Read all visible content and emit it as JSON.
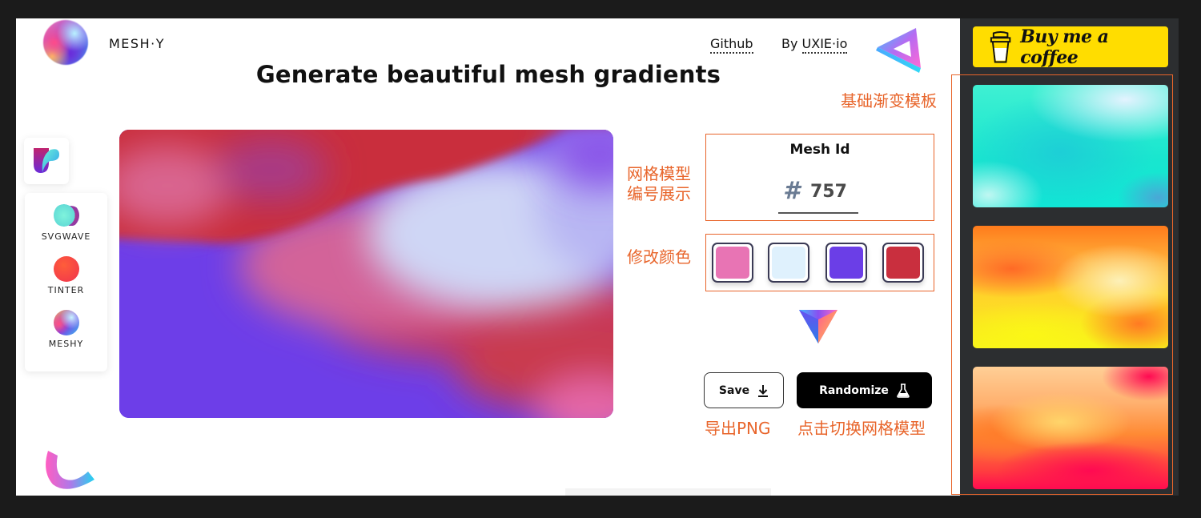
{
  "header": {
    "brand": "MESH·Y",
    "title": "Generate beautiful mesh gradients",
    "links": [
      {
        "label": "Github"
      },
      {
        "prefix": "By ",
        "label": "UXIE·io"
      }
    ]
  },
  "sidebar": {
    "items": [
      {
        "label": "SVGWAVE",
        "icon": "svgwave-icon"
      },
      {
        "label": "TINTER",
        "icon": "tinter-icon"
      },
      {
        "label": "MESHY",
        "icon": "meshy-icon"
      }
    ]
  },
  "mesh": {
    "id_label": "Mesh Id",
    "hash": "#",
    "id_value": "757",
    "colors": [
      "#e874b4",
      "#dff1fd",
      "#6b3ee7",
      "#c92f3e"
    ]
  },
  "buttons": {
    "save": "Save",
    "randomize": "Randomize"
  },
  "annotations": {
    "templates": "基础渐变模板",
    "mesh_id_line1": "网格模型",
    "mesh_id_line2": "编号展示",
    "colors": "修改颜色",
    "export": "导出PNG",
    "randomize": "点击切换网格模型",
    "color": "#e8652b"
  },
  "right_panel": {
    "coffee": "Buy me a coffee",
    "templates": [
      {
        "name": "teal"
      },
      {
        "name": "sunset-yellow"
      },
      {
        "name": "peach-red"
      }
    ]
  }
}
